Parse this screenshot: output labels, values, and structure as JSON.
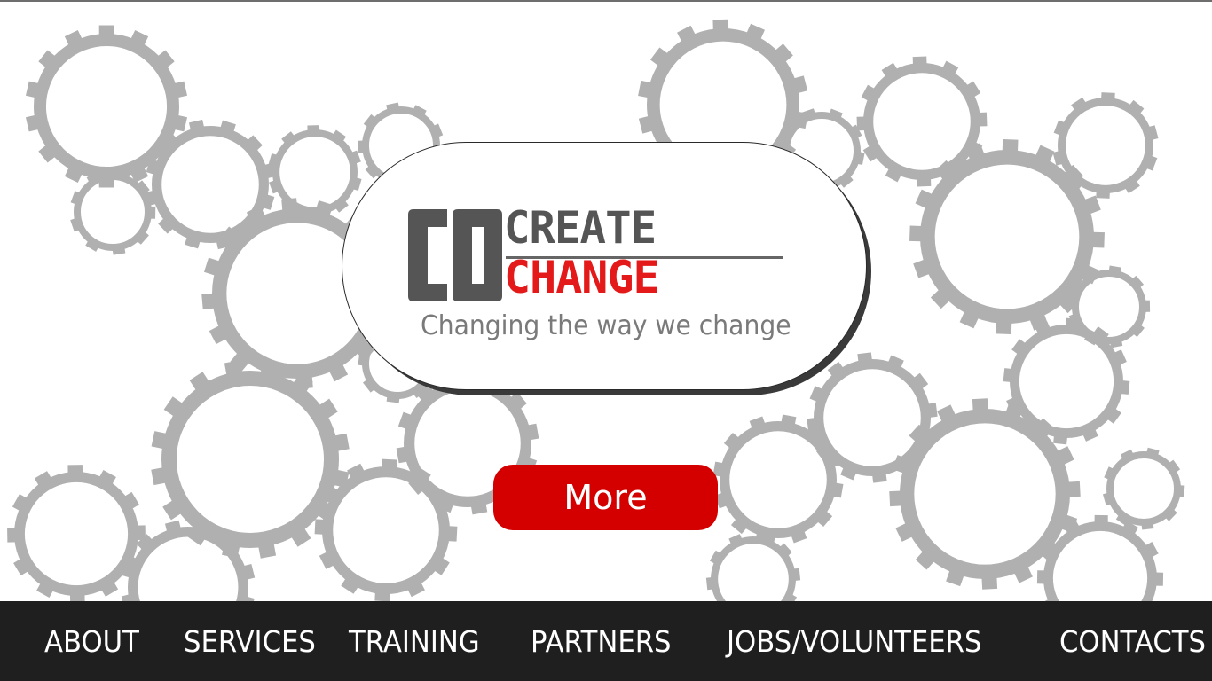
{
  "logo": {
    "co": "CO",
    "create": "CREATE",
    "change": "CHANGE",
    "tagline": "Changing the way we change"
  },
  "more_button": {
    "label": "More"
  },
  "nav": {
    "items": [
      {
        "label": "ABOUT"
      },
      {
        "label": "SERVICES"
      },
      {
        "label": "TRAINING"
      },
      {
        "label": "PARTNERS"
      },
      {
        "label": "JOBS/VOLUNTEERS"
      },
      {
        "label": "CONTACTS"
      }
    ]
  },
  "colors": {
    "gear": "#b0b0b0",
    "brand_red": "#e41a1a",
    "button_red": "#d40000",
    "nav_bg": "#1f1f1f",
    "logo_gray": "#555555"
  },
  "icons": {
    "background": "gear-icon"
  }
}
